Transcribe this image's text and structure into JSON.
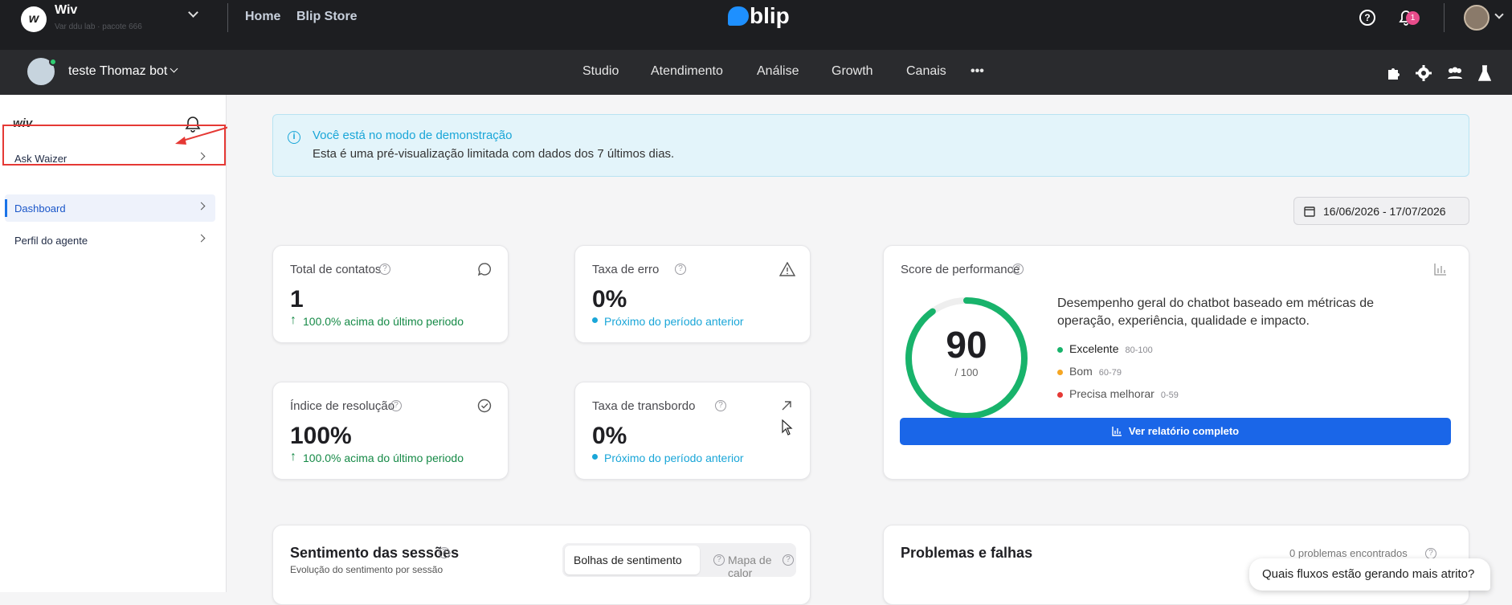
{
  "topbar": {
    "org_name": "Wiv",
    "org_subtitle": "Var ddu lab · pacote 666",
    "home": "Home",
    "store": "Blip Store",
    "brand": "blip",
    "notif_count": "1"
  },
  "botbar": {
    "bot_name": "teste Thomaz bot",
    "nav": [
      "Studio",
      "Atendimento",
      "Análise",
      "Growth",
      "Canais"
    ],
    "more": "•••"
  },
  "sidebar": {
    "logo": "wiv",
    "items": [
      {
        "label": "Ask Waizer"
      },
      {
        "label": "Dashboard"
      },
      {
        "label": "Perfil do agente"
      }
    ]
  },
  "banner": {
    "title": "Você está no modo de demonstração",
    "text": "Esta é uma pré-visualização limitada com dados dos 7 últimos dias."
  },
  "date_range": "16/06/2026 - 17/07/2026",
  "metrics": [
    {
      "label": "Total de contatos",
      "value": "1",
      "trend": "100.0% acima do último periodo"
    },
    {
      "label": "Taxa de erro",
      "value": "0%",
      "trend": "Próximo do período anterior"
    },
    {
      "label": "Índice de resolução",
      "value": "100%",
      "trend": "100.0% acima do último periodo"
    },
    {
      "label": "Taxa de transbordo",
      "value": "0%",
      "trend": "Próximo do período anterior"
    }
  ],
  "score": {
    "title": "Score de performance",
    "value": "90",
    "max": "/ 100",
    "fraction": 0.9,
    "desc": "Desempenho geral do chatbot baseado em métricas de operação, experiência, qualidade e impacto.",
    "legend": [
      {
        "label": "Excelente",
        "range": "80-100",
        "color": "#18b36b"
      },
      {
        "label": "Bom",
        "range": "60-79",
        "color": "#f5a623"
      },
      {
        "label": "Precisa melhorar",
        "range": "0-59",
        "color": "#e53935"
      }
    ],
    "button": "Ver relatório completo"
  },
  "sentiment": {
    "title": "Sentimento das sessões",
    "subtitle": "Evolução do sentimento por sessão",
    "tab1": "Bolhas de sentimento",
    "tab2": "Mapa de calor"
  },
  "problems": {
    "title": "Problemas e falhas",
    "count": "0 problemas encontrados"
  },
  "chat_bubble": "Quais fluxos estão gerando mais atrito?",
  "colors": {
    "accent": "#1a73e8",
    "score_ring": "#18b36b",
    "positive": "#168a47",
    "neutral": "#1aa6d8",
    "highlight": "#e53935"
  }
}
